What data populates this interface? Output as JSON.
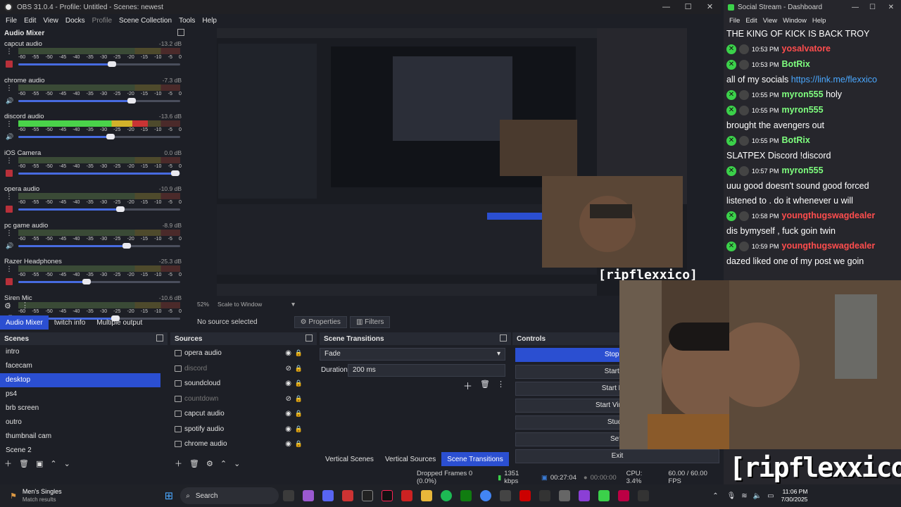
{
  "window": {
    "title": "OBS 31.0.4 - Profile: Untitled - Scenes: newest"
  },
  "menu": [
    "File",
    "Edit",
    "View",
    "Docks",
    "Profile",
    "Scene Collection",
    "Tools",
    "Help"
  ],
  "mixer": {
    "title": "Audio Mixer",
    "ticks": [
      "-60",
      "-55",
      "-50",
      "-45",
      "-40",
      "-35",
      "-30",
      "-25",
      "-20",
      "-15",
      "-10",
      "-5",
      "0"
    ],
    "channels": [
      {
        "name": "capcut audio",
        "db": "-13.2 dB",
        "level": 0,
        "volume": 0.58,
        "muted": true
      },
      {
        "name": "chrome audio",
        "db": "-7.3 dB",
        "level": 0,
        "volume": 0.7,
        "muted": false
      },
      {
        "name": "discord audio",
        "db": "-13.6 dB",
        "level": 0.8,
        "volume": 0.57,
        "muted": false
      },
      {
        "name": "iOS Camera",
        "db": "0.0 dB",
        "level": 0,
        "volume": 0.97,
        "muted": true
      },
      {
        "name": "opera audio",
        "db": "-10.9 dB",
        "level": 0,
        "volume": 0.63,
        "muted": true
      },
      {
        "name": "pc game audio",
        "db": "-8.9 dB",
        "level": 0,
        "volume": 0.67,
        "muted": false
      },
      {
        "name": "Razer Headphones",
        "db": "-25.3 dB",
        "level": 0,
        "volume": 0.42,
        "muted": true
      },
      {
        "name": "Siren Mic",
        "db": "-10.6 dB",
        "level": 0,
        "volume": 0.6,
        "muted": false
      }
    ]
  },
  "zoom": {
    "percent": "52%",
    "mode": "Scale to Window"
  },
  "bottom_tabs": [
    "Audio Mixer",
    "twitch info",
    "Multiple output"
  ],
  "properties": {
    "no_source": "No source selected",
    "props": "Properties",
    "filters": "Filters"
  },
  "scenes": {
    "title": "Scenes",
    "items": [
      "intro",
      "facecam",
      "desktop",
      "ps4",
      "brb screen",
      "outro",
      "thumbnail cam",
      "Scene 2"
    ],
    "selected": 2
  },
  "sources": {
    "title": "Sources",
    "items": [
      {
        "name": "opera audio",
        "visible": true
      },
      {
        "name": "discord",
        "visible": false
      },
      {
        "name": "soundcloud",
        "visible": true
      },
      {
        "name": "countdown",
        "visible": false
      },
      {
        "name": "capcut audio",
        "visible": true
      },
      {
        "name": "spotify audio",
        "visible": true
      },
      {
        "name": "chrome audio",
        "visible": true
      }
    ]
  },
  "transitions": {
    "title": "Scene Transitions",
    "type": "Fade",
    "duration_label": "Duration",
    "duration": "200 ms",
    "tabs": [
      "Vertical Scenes",
      "Vertical Sources",
      "Scene Transitions"
    ]
  },
  "controls": {
    "title": "Controls",
    "buttons": [
      "Stop Str",
      "Start Re",
      "Start Repl",
      "Start Virtual C",
      "Studio",
      "Setti",
      "Exit"
    ]
  },
  "status": {
    "dropped": "Dropped Frames 0 (0.0%)",
    "bitrate": "1351 kbps",
    "live_time": "00:27:04",
    "rec_time": "00:00:00",
    "cpu": "CPU: 3.4%",
    "fps": "60.00 / 60.00 FPS"
  },
  "social": {
    "title": "Social Stream - Dashboard",
    "menu": [
      "File",
      "Edit",
      "View",
      "Window",
      "Help"
    ],
    "messages": [
      {
        "time": "",
        "name": "",
        "text": "THE KING OF KICK IS BACK TROY",
        "color": "#ffffff"
      },
      {
        "time": "10:53 PM",
        "name": "yosalvatore",
        "text": "",
        "color": "#ff4d4d"
      },
      {
        "time": "10:53 PM",
        "name": "BotRix",
        "text": "",
        "color": "#7fff7f"
      },
      {
        "time": "",
        "name": "",
        "text": "all of my socials",
        "link": "https://link.me/flexxico",
        "color": "#ffffff"
      },
      {
        "time": "10:55 PM",
        "name": "myron555",
        "text": "holy",
        "color": "#7fff7f"
      },
      {
        "time": "10:55 PM",
        "name": "myron555",
        "text": "",
        "color": "#7fff7f"
      },
      {
        "time": "",
        "name": "",
        "text": "brought the avengers out",
        "color": "#ffffff"
      },
      {
        "time": "10:55 PM",
        "name": "BotRix",
        "text": "",
        "color": "#7fff7f"
      },
      {
        "time": "",
        "name": "",
        "text": "SLATPEX Discord !discord",
        "color": "#ffffff"
      },
      {
        "time": "10:57 PM",
        "name": "myron555",
        "text": "",
        "color": "#7fff7f"
      },
      {
        "time": "",
        "name": "",
        "text": "uuu good doesn't sound good forced",
        "color": "#ffffff"
      },
      {
        "time": "",
        "name": "",
        "text": "listened to . do it whenever u will",
        "color": "#ffffff"
      },
      {
        "time": "10:58 PM",
        "name": "youngthugswagdealer",
        "text": "",
        "color": "#ff4d4d"
      },
      {
        "time": "",
        "name": "",
        "text": "dis bymyself , fuck goin twin",
        "color": "#ffffff"
      },
      {
        "time": "10:59 PM",
        "name": "youngthugswagdealer",
        "text": "",
        "color": "#ff4d4d"
      },
      {
        "time": "",
        "name": "",
        "text": "dazed liked one of my post we goin",
        "color": "#ffffff"
      }
    ]
  },
  "overlay": {
    "handle": "[ripflexxico]"
  },
  "taskbar": {
    "app_title": "Men's Singles",
    "app_sub": "Match results",
    "search": "Search",
    "time": "11:06 PM",
    "date": "7/30/2025"
  }
}
